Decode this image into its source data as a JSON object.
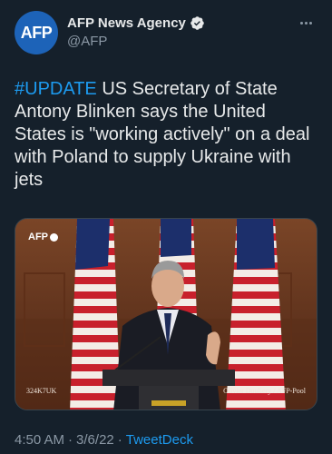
{
  "author": {
    "avatar_text": "AFP",
    "display_name": "AFP News Agency",
    "handle": "@AFP",
    "verified": true
  },
  "tweet": {
    "hashtag": "#UPDATE",
    "text": " US Secretary of State Antony Blinken says the United States is \"working actively\" on a deal with Poland to supply Ukraine with jets"
  },
  "media": {
    "logo_text": "AFP",
    "caption_left": "324K7UK",
    "caption_right": "Olivier Douliery / AFP-Pool"
  },
  "meta": {
    "time": "4:50 AM",
    "separator": "·",
    "date": "3/6/22",
    "separator2": "·",
    "source": "TweetDeck"
  },
  "colors": {
    "background": "#15202b",
    "accent": "#1d9bf0",
    "muted": "#8b98a5",
    "avatar_bg": "#1d63b8"
  },
  "icons": {
    "more": "more-horizontal-icon",
    "verified": "verified-badge-icon"
  }
}
